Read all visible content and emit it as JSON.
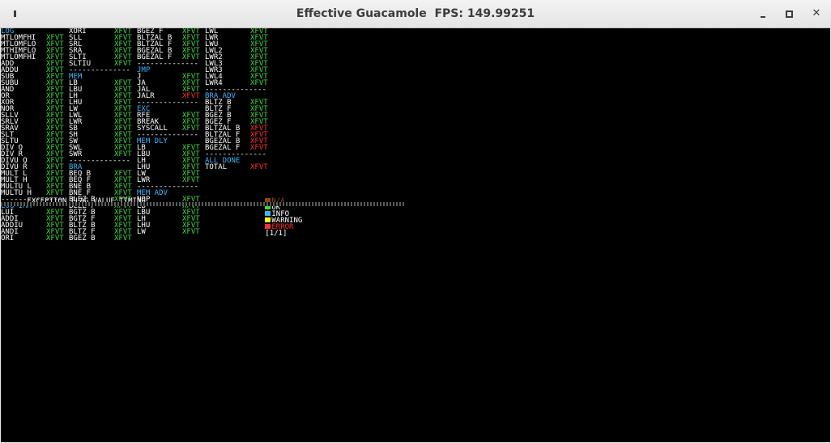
{
  "window": {
    "title": "Effective Guacamole  FPS: 149.99251"
  },
  "colors": {
    "ok": "#3cdc3c",
    "error": "#ff3030",
    "header": "#33b8ff",
    "na": "#8b4513",
    "info": "#33b8ff",
    "warning": "#ffff00"
  },
  "columns": [
    {
      "rows": [
        {
          "name": "LOG",
          "hdr": true
        },
        {
          "name": "MTLOMFHI",
          "st": "XFVT"
        },
        {
          "name": "MTLOMFLO",
          "st": "XFVT"
        },
        {
          "name": "MTHIMFLO",
          "st": "XFVT"
        },
        {
          "name": "MTLOMFHI",
          "st": "XFVT"
        },
        {
          "name": "ADD",
          "st": "XFVT"
        },
        {
          "name": "ADDU",
          "st": "XFVT"
        },
        {
          "name": "SUB",
          "st": "XFVT"
        },
        {
          "name": "SUBU",
          "st": "XFVT"
        },
        {
          "name": "AND",
          "st": "XFVT"
        },
        {
          "name": "OR",
          "st": "XFVT"
        },
        {
          "name": "XOR",
          "st": "XFVT"
        },
        {
          "name": "NOR",
          "st": "XFVT"
        },
        {
          "name": "SLLV",
          "st": "XFVT"
        },
        {
          "name": "SRLV",
          "st": "XFVT"
        },
        {
          "name": "SRAV",
          "st": "XFVT"
        },
        {
          "name": "SLT",
          "st": "XFVT"
        },
        {
          "name": "SLTU",
          "st": "XFVT"
        },
        {
          "name": "DIV Q",
          "st": "XFVT"
        },
        {
          "name": "DIV R",
          "st": "XFVT"
        },
        {
          "name": "DIVU Q",
          "st": "XFVT"
        },
        {
          "name": "DIVU R",
          "st": "XFVT"
        },
        {
          "name": "MULT L",
          "st": "XFVT"
        },
        {
          "name": "MULT H",
          "st": "XFVT"
        },
        {
          "name": "MULTU L",
          "st": "XFVT"
        },
        {
          "name": "MULTU H",
          "st": "XFVT"
        },
        {
          "dash": "--------------"
        },
        {
          "name": "LOG IMM",
          "hdr": true
        },
        {
          "name": "LUI",
          "st": "XFVT"
        },
        {
          "name": "ADDI",
          "st": "XFVT"
        },
        {
          "name": "ADDIU",
          "st": "XFVT"
        },
        {
          "name": "ANDI",
          "st": "XFVT"
        },
        {
          "name": "ORI",
          "st": "XFVT"
        }
      ]
    },
    {
      "rows": [
        {
          "name": "XORI",
          "st": "XFVT"
        },
        {
          "name": "SLL",
          "st": "XFVT"
        },
        {
          "name": "SRL",
          "st": "XFVT"
        },
        {
          "name": "SRA",
          "st": "XFVT"
        },
        {
          "name": "SLTI",
          "st": "XFVT"
        },
        {
          "name": "SLTIU",
          "st": "XFVT"
        },
        {
          "dash": "--------------"
        },
        {
          "name": "MEM",
          "hdr": true
        },
        {
          "name": "LB",
          "st": "XFVT"
        },
        {
          "name": "LBU",
          "st": "XFVT"
        },
        {
          "name": "LH",
          "st": "XFVT"
        },
        {
          "name": "LHU",
          "st": "XFVT"
        },
        {
          "name": "LW",
          "st": "XFVT"
        },
        {
          "name": "LWL",
          "st": "XFVT"
        },
        {
          "name": "LWR",
          "st": "XFVT"
        },
        {
          "name": "SB",
          "st": "XFVT"
        },
        {
          "name": "SH",
          "st": "XFVT"
        },
        {
          "name": "SW",
          "st": "XFVT"
        },
        {
          "name": "SWL",
          "st": "XFVT"
        },
        {
          "name": "SWR",
          "st": "XFVT"
        },
        {
          "dash": "--------------"
        },
        {
          "name": "BRA",
          "hdr": true
        },
        {
          "name": "BEQ B",
          "st": "XFVT"
        },
        {
          "name": "BEQ F",
          "st": "XFVT"
        },
        {
          "name": "BNE B",
          "st": "XFVT"
        },
        {
          "name": "BNE F",
          "st": "XFVT"
        },
        {
          "name": "BLEZ B",
          "st": "XFVT"
        },
        {
          "name": "BLEZ F",
          "st": "XFVT"
        },
        {
          "name": "BGTZ B",
          "st": "XFVT"
        },
        {
          "name": "BGTZ F",
          "st": "XFVT"
        },
        {
          "name": "BLTZ B",
          "st": "XFVT"
        },
        {
          "name": "BLTZ F",
          "st": "XFVT"
        },
        {
          "name": "BGEZ B",
          "st": "XFVT"
        }
      ]
    },
    {
      "rows": [
        {
          "name": "BGEZ F",
          "st": "XFVT"
        },
        {
          "name": "BLTZAL B",
          "st": "XFVT"
        },
        {
          "name": "BLTZAL F",
          "st": "XFVT"
        },
        {
          "name": "BGEZAL B",
          "st": "XFVT"
        },
        {
          "name": "BGEZAL F",
          "st": "XFVT"
        },
        {
          "dash": "--------------"
        },
        {
          "name": "JMP",
          "hdr": true
        },
        {
          "name": "J",
          "st": "XFVT"
        },
        {
          "name": "JA",
          "st": "XFVT"
        },
        {
          "name": "JAL",
          "st": "XFVT"
        },
        {
          "name": "JALR",
          "st": "XFVT",
          "err": true
        },
        {
          "dash": "--------------"
        },
        {
          "name": "EXC",
          "hdr": true
        },
        {
          "name": "RFE",
          "st": "XFVT"
        },
        {
          "name": "BREAK",
          "st": "XFVT"
        },
        {
          "name": "SYSCALL",
          "st": "XFVT"
        },
        {
          "dash": "--------------"
        },
        {
          "name": "MEM DLY",
          "hdr": true
        },
        {
          "name": "LB",
          "st": "XFVT"
        },
        {
          "name": "LBU",
          "st": "XFVT"
        },
        {
          "name": "LH",
          "st": "XFVT"
        },
        {
          "name": "LHU",
          "st": "XFVT"
        },
        {
          "name": "LW",
          "st": "XFVT"
        },
        {
          "name": "LWR",
          "st": "XFVT"
        },
        {
          "dash": "--------------"
        },
        {
          "name": "MEM ADV",
          "hdr": true
        },
        {
          "name": "NOP",
          "st": "XFVT"
        },
        {
          "name": "LB",
          "st": "XFVT"
        },
        {
          "name": "LBU",
          "st": "XFVT"
        },
        {
          "name": "LH",
          "st": "XFVT"
        },
        {
          "name": "LHU",
          "st": "XFVT"
        },
        {
          "name": "LW",
          "st": "XFVT"
        }
      ]
    },
    {
      "rows": [
        {
          "name": "LWL",
          "st": "XFVT"
        },
        {
          "name": "LWR",
          "st": "XFVT"
        },
        {
          "name": "LWU",
          "st": "XFVT"
        },
        {
          "name": "LWL2",
          "st": "XFVT"
        },
        {
          "name": "LWR2",
          "st": "XFVT"
        },
        {
          "name": "LWL3",
          "st": "XFVT"
        },
        {
          "name": "LWR3",
          "st": "XFVT"
        },
        {
          "name": "LWL4",
          "st": "XFVT"
        },
        {
          "name": "LWR4",
          "st": "XFVT"
        },
        {
          "dash": "--------------"
        },
        {
          "name": "BRA ADV",
          "hdr": true
        },
        {
          "name": "BLTZ B",
          "st": "XFVT"
        },
        {
          "name": "BLTZ F",
          "st": "XFVT"
        },
        {
          "name": "BGEZ B",
          "st": "XFVT"
        },
        {
          "name": "BGEZ F",
          "st": "XFVT"
        },
        {
          "name": "BLTZAL B",
          "st": "XFVT",
          "err": true
        },
        {
          "name": "BLTZAL F",
          "st": "XFVT",
          "err": true
        },
        {
          "name": "BGEZAL B",
          "st": "XFVT",
          "err": true
        },
        {
          "name": "BGEZAL F",
          "st": "XFVT",
          "err": true
        },
        {
          "dash": "--------------"
        },
        {
          "name": "ALL DONE",
          "hdr": true
        },
        {
          "name": "TOTAL",
          "st": "XFVT",
          "err": true
        }
      ]
    }
  ],
  "statusbar": {
    "legend_text": "EXCEPTION FLAG VALUE TIMING",
    "na": "N/A",
    "ok": "OK",
    "info": "INFO",
    "warning": "WARNING",
    "error": "ERROR",
    "page": "[1/1]"
  }
}
